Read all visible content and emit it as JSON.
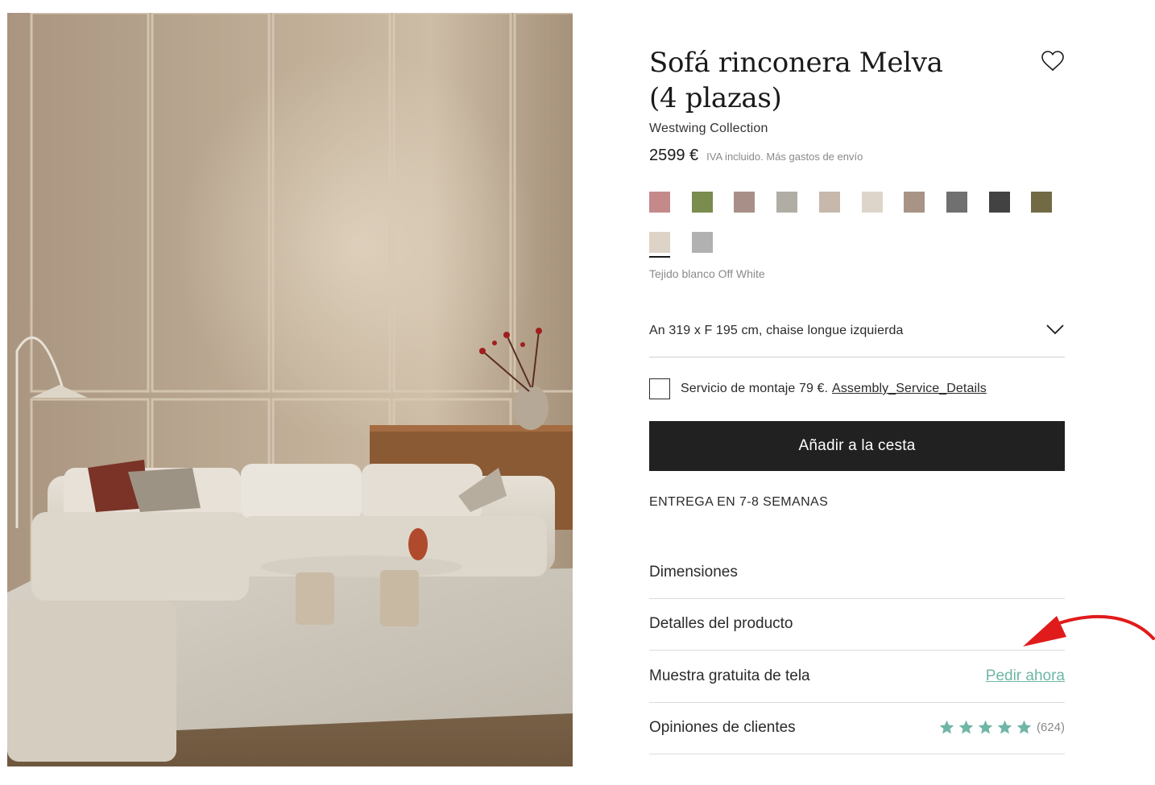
{
  "product": {
    "title_line1": "Sofá rinconera Melva",
    "title_line2": "(4 plazas)",
    "brand": "Westwing Collection",
    "price": "2599 €",
    "tax_note": "IVA incluido. Más gastos de envío",
    "selected_color_name": "Tejido blanco Off White",
    "image_alt": "sofa-room-photo"
  },
  "swatches": [
    {
      "color": "#c48a8a"
    },
    {
      "color": "#7a8c4e"
    },
    {
      "color": "#a89088"
    },
    {
      "color": "#b0ada4"
    },
    {
      "color": "#c6b9ab"
    },
    {
      "color": "#ddd5ca"
    },
    {
      "color": "#a79486"
    },
    {
      "color": "#707070"
    },
    {
      "color": "#424242"
    },
    {
      "color": "#726a45"
    },
    {
      "color": "#ddd3c6",
      "selected": true
    },
    {
      "color": "#b1b1b1"
    }
  ],
  "size_selector": {
    "value": "An 319 x F 195 cm, chaise longue izquierda"
  },
  "assembly": {
    "label": "Servicio de montaje 79 €.",
    "link": "Assembly_Service_Details"
  },
  "add_to_cart": "Añadir a la cesta",
  "delivery": "ENTREGA EN 7-8 SEMANAS",
  "accordion": {
    "dimensions": "Dimensiones",
    "details": "Detalles del producto",
    "sample": "Muestra gratuita de tela",
    "sample_link": "Pedir ahora",
    "reviews": "Opiniones de clientes",
    "review_count": "(624)",
    "rating": 5
  },
  "colors": {
    "accent": "#6fb6a6",
    "button": "#212121",
    "annotation_arrow": "#e01b1b"
  },
  "icons": {
    "favorite": "heart-icon",
    "dropdown": "chevron-down-icon",
    "rating": "star-icon",
    "annotation": "red-arrow-annotation"
  }
}
